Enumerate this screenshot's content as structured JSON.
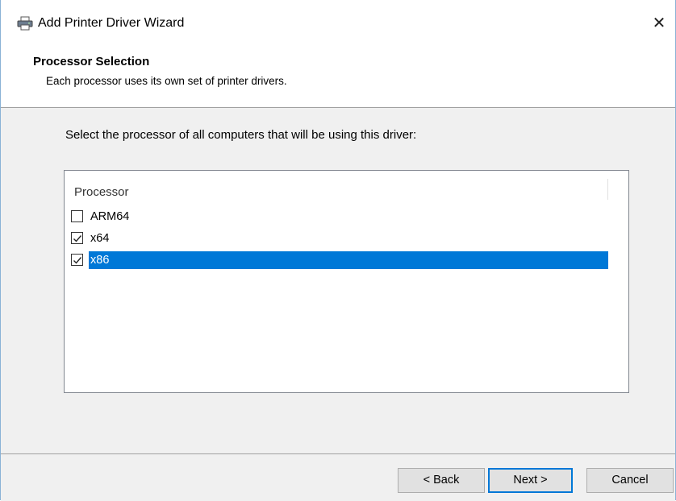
{
  "window": {
    "title": "Add Printer Driver Wizard",
    "close_symbol": "✕"
  },
  "header": {
    "title": "Processor Selection",
    "subtitle": "Each processor uses its own set of printer drivers."
  },
  "main": {
    "instruction": "Select the processor of all computers that will be using this driver:",
    "list": {
      "column_header": "Processor",
      "items": [
        {
          "label": "ARM64",
          "checked": false,
          "selected": false
        },
        {
          "label": "x64",
          "checked": true,
          "selected": false
        },
        {
          "label": "x86",
          "checked": true,
          "selected": true
        }
      ]
    }
  },
  "footer": {
    "back_label": "< Back",
    "next_label": "Next >",
    "cancel_label": "Cancel"
  },
  "colors": {
    "selection": "#0078d7",
    "window_border": "#8ab2d6"
  },
  "icons": {
    "title_icon": "printer-icon",
    "close_icon": "close-icon",
    "checkbox_check": "checkmark-icon"
  }
}
